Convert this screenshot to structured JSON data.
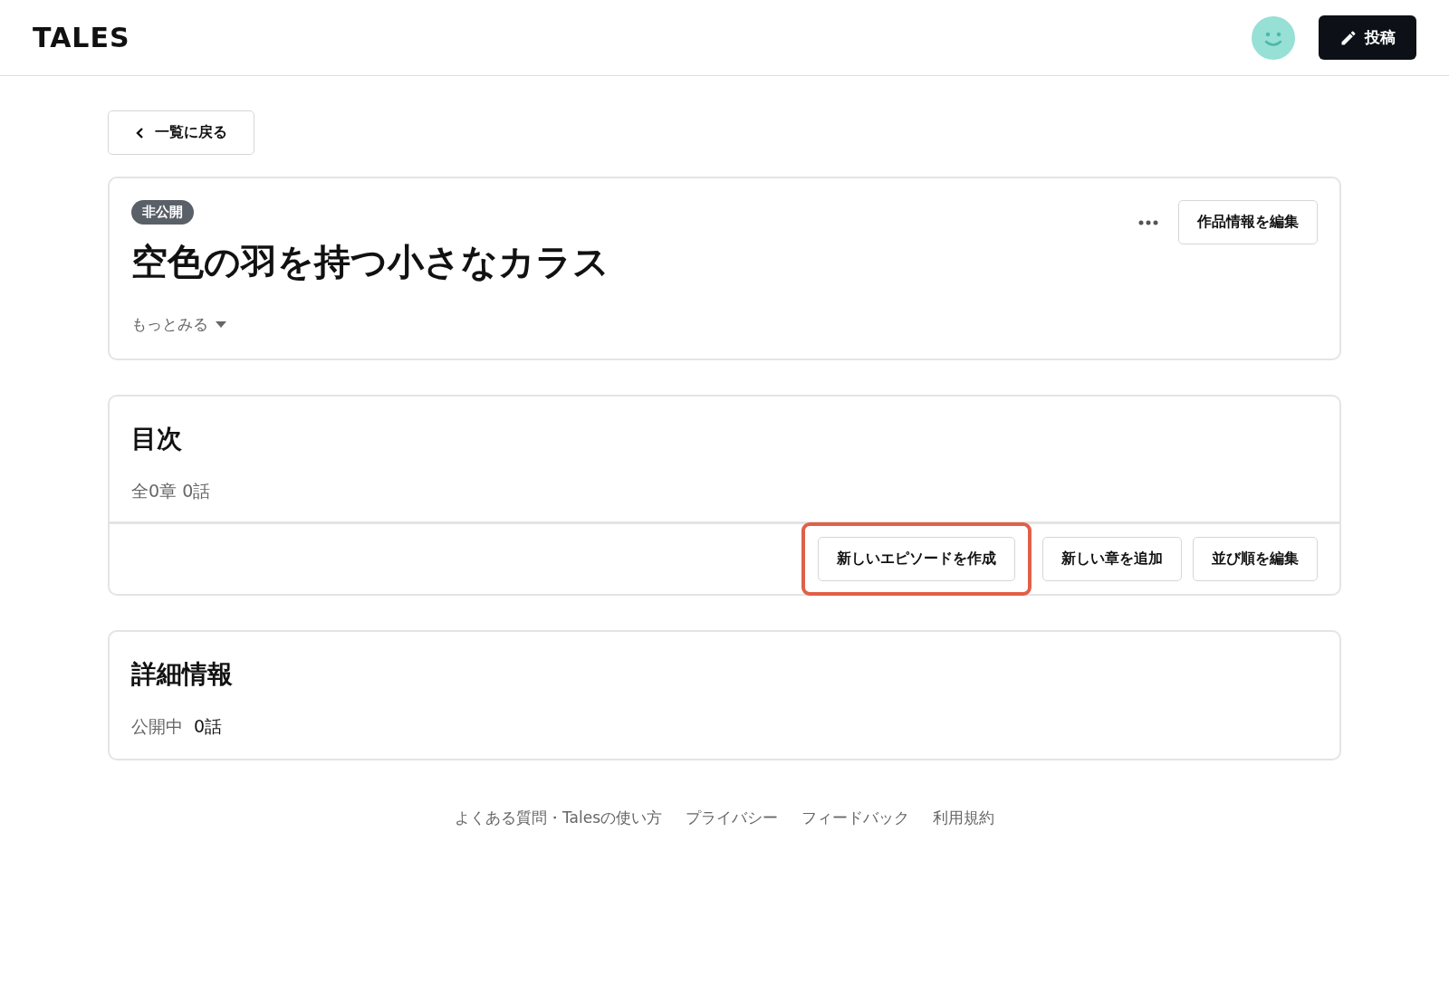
{
  "header": {
    "logo": "TALES",
    "post_button": "投稿"
  },
  "back_button": "一覧に戻る",
  "work": {
    "status_badge": "非公開",
    "title": "空色の羽を持つ小さなカラス",
    "more_toggle": "もっとみる",
    "edit_button": "作品情報を編集"
  },
  "toc": {
    "heading": "目次",
    "summary": "全0章 0話",
    "buttons": [
      {
        "label": "新しいエピソードを作成",
        "highlighted": true
      },
      {
        "label": "新しい章を追加",
        "highlighted": false
      },
      {
        "label": "並び順を編集",
        "highlighted": false
      }
    ]
  },
  "details": {
    "heading": "詳細情報",
    "label": "公開中",
    "value": "0話"
  },
  "footer_links": [
    "よくある質問・Talesの使い方",
    "プライバシー",
    "フィードバック",
    "利用規約"
  ]
}
